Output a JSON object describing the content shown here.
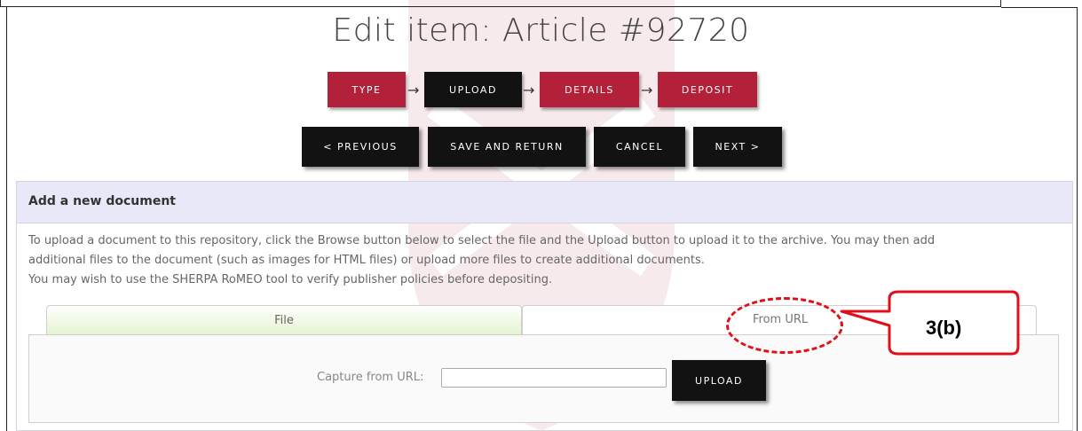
{
  "page": {
    "title": "Edit item: Article #92720"
  },
  "workflow_steps": [
    {
      "label": "TYPE",
      "state": "done"
    },
    {
      "label": "UPLOAD",
      "state": "current"
    },
    {
      "label": "DETAILS",
      "state": "todo"
    },
    {
      "label": "DEPOSIT",
      "state": "todo"
    }
  ],
  "nav_buttons": {
    "previous": "< PREVIOUS",
    "save_and_return": "SAVE AND RETURN",
    "cancel": "CANCEL",
    "next": "NEXT >"
  },
  "panel": {
    "title": "Add a new document",
    "intro_line1": "To upload a document to this repository, click the Browse button below to select the file and the Upload button to upload it to the archive. You may then add",
    "intro_line2": "additional files to the document (such as images for HTML files) or upload more files to create additional documents.",
    "intro_line3": "You may wish to use the SHERPA RoMEO tool to verify publisher policies before depositing."
  },
  "tabs": [
    {
      "label": "File",
      "active": false
    },
    {
      "label": "From URL",
      "active": true
    }
  ],
  "url_capture": {
    "label": "Capture from URL:",
    "value": "",
    "upload_label": "UPLOAD"
  },
  "annotation": {
    "label": "3(b)",
    "color": "#e0101a"
  },
  "colors": {
    "step_red": "#b3203a",
    "button_black": "#121212",
    "panel_header_bg": "#e8e8f8"
  }
}
